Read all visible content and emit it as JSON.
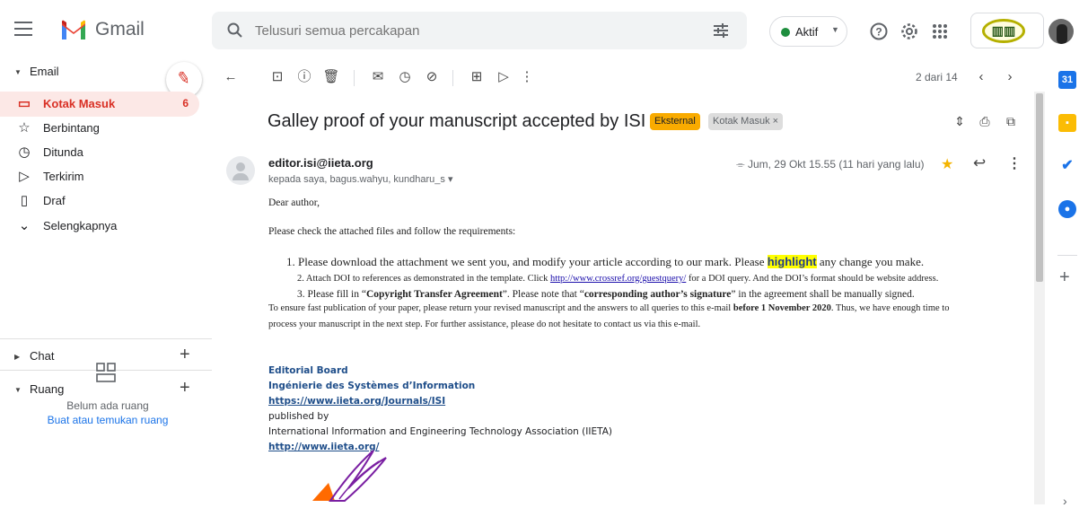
{
  "app": {
    "brand": "Gmail"
  },
  "search": {
    "placeholder": "Telusuri semua percakapan"
  },
  "status": {
    "label": "Aktif"
  },
  "sidebar": {
    "email_section": "Email",
    "items": [
      {
        "label": "Kotak Masuk",
        "count": "6",
        "icon": "inbox-icon",
        "active": true
      },
      {
        "label": "Berbintang",
        "icon": "star-outline-icon"
      },
      {
        "label": "Ditunda",
        "icon": "clock-icon"
      },
      {
        "label": "Terkirim",
        "icon": "send-icon"
      },
      {
        "label": "Draf",
        "icon": "draft-icon"
      },
      {
        "label": "Selengkapnya",
        "icon": "chevron-down-icon"
      }
    ],
    "chat_section": "Chat",
    "rooms_section": "Ruang",
    "rooms_empty": "Belum ada ruang",
    "rooms_link": "Buat atau temukan ruang"
  },
  "toolbar": {
    "pager": "2 dari 14"
  },
  "message": {
    "subject": "Galley proof of your manuscript accepted by ISI",
    "labels": [
      "Eksternal",
      "Kotak Masuk ×"
    ],
    "sender": "editor.isi@iieta.org",
    "recipients": "kepada saya, bagus.wahyu, kundharu_s ▾",
    "date": "Jum, 29 Okt 15.55 (11 hari yang lalu)",
    "greeting": "Dear author,",
    "intro": "Please check the attached files and follow the requirements:",
    "item1_pre": "1. Please download the attachment we sent you, and modify your article according to our mark. Please ",
    "item1_hl": "highlight",
    "item1_post": " any change you make.",
    "item2_pre": "2. Attach DOI to references as demonstrated in the template. Click ",
    "item2_link": "http://www.crossref.org/guestquery/",
    "item2_post": " for a DOI query. And the DOI’s format should be website address.",
    "item3_pre": "3. Please fill in “",
    "item3_b1": "Copyright Transfer Agreement",
    "item3_mid": "”. Please note that “",
    "item3_b2": "corresponding author’s signature",
    "item3_post": "” in the agreement shall be manually signed.",
    "para1_pre": "To ensure fast publication of your paper, please return your revised manuscript and the answers to all queries to this e-mail ",
    "para1_b": "before 1 November 2020",
    "para1_post": ". Thus, we have enough time to",
    "para2": "process your manuscript in the next step. For further assistance, please do not hesitate to contact us via this e-mail.",
    "signature": {
      "board": "Editorial Board",
      "journal": "Ingénierie des Systèmes d’Information",
      "journal_url": "https://www.iieta.org/Journals/ISI",
      "published_by": "published by",
      "association": "International Information and Engineering Technology Association (IIETA)",
      "assoc_url": "http://www.iieta.org/"
    }
  },
  "colors": {
    "accent_red": "#d93025",
    "label_orange": "#f9ab00",
    "active_bg": "#fce8e6",
    "link_blue": "#1a73e8"
  }
}
